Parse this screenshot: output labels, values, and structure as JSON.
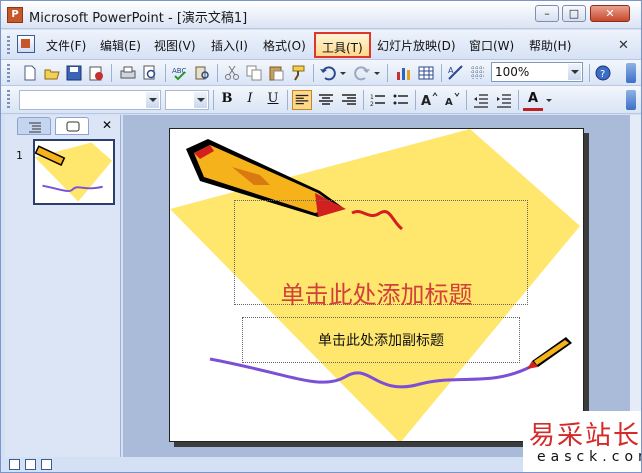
{
  "window": {
    "title": "Microsoft PowerPoint - [演示文稿1]",
    "controls": {
      "minimize": "–",
      "maximize": "□",
      "close": "✕"
    }
  },
  "menubar": {
    "items": [
      {
        "label": "文件(F)"
      },
      {
        "label": "编辑(E)"
      },
      {
        "label": "视图(V)"
      },
      {
        "label": "插入(I)"
      },
      {
        "label": "格式(O)"
      },
      {
        "label": "工具(T)",
        "highlighted": true
      },
      {
        "label": "幻灯片放映(D)"
      },
      {
        "label": "窗口(W)"
      },
      {
        "label": "帮助(H)"
      }
    ],
    "close_glyph": "✕"
  },
  "toolbar": {
    "zoom": "100%",
    "icons": [
      "new-icon",
      "open-icon",
      "save-icon",
      "permission-icon",
      "print-icon",
      "print-preview-icon",
      "spelling-icon",
      "research-icon",
      "cut-icon",
      "copy-icon",
      "paste-icon",
      "format-painter-icon",
      "undo-icon",
      "redo-icon",
      "insert-chart-icon",
      "insert-table-icon",
      "insert-diagram-icon",
      "show-grid-icon",
      "help-icon"
    ]
  },
  "formatting": {
    "font_name": "",
    "font_size": "",
    "bold": "B",
    "italic": "I",
    "underline": "U",
    "align_left_active": true,
    "font_color_label": "A",
    "font_color": "#c02020"
  },
  "slide_pane": {
    "slide_number": "1",
    "close_glyph": "✕"
  },
  "slide": {
    "title_placeholder": "单击此处添加标题",
    "subtitle_placeholder": "单击此处添加副标题",
    "colors": {
      "diamond": "#ffe66d",
      "squiggle": "#7b4fd6",
      "title": "#d2403c",
      "pencil_body": "#f6b21b",
      "pencil_tip": "#d22020"
    }
  },
  "watermark": {
    "cn": "易采站长站",
    "en": "easck.com"
  }
}
